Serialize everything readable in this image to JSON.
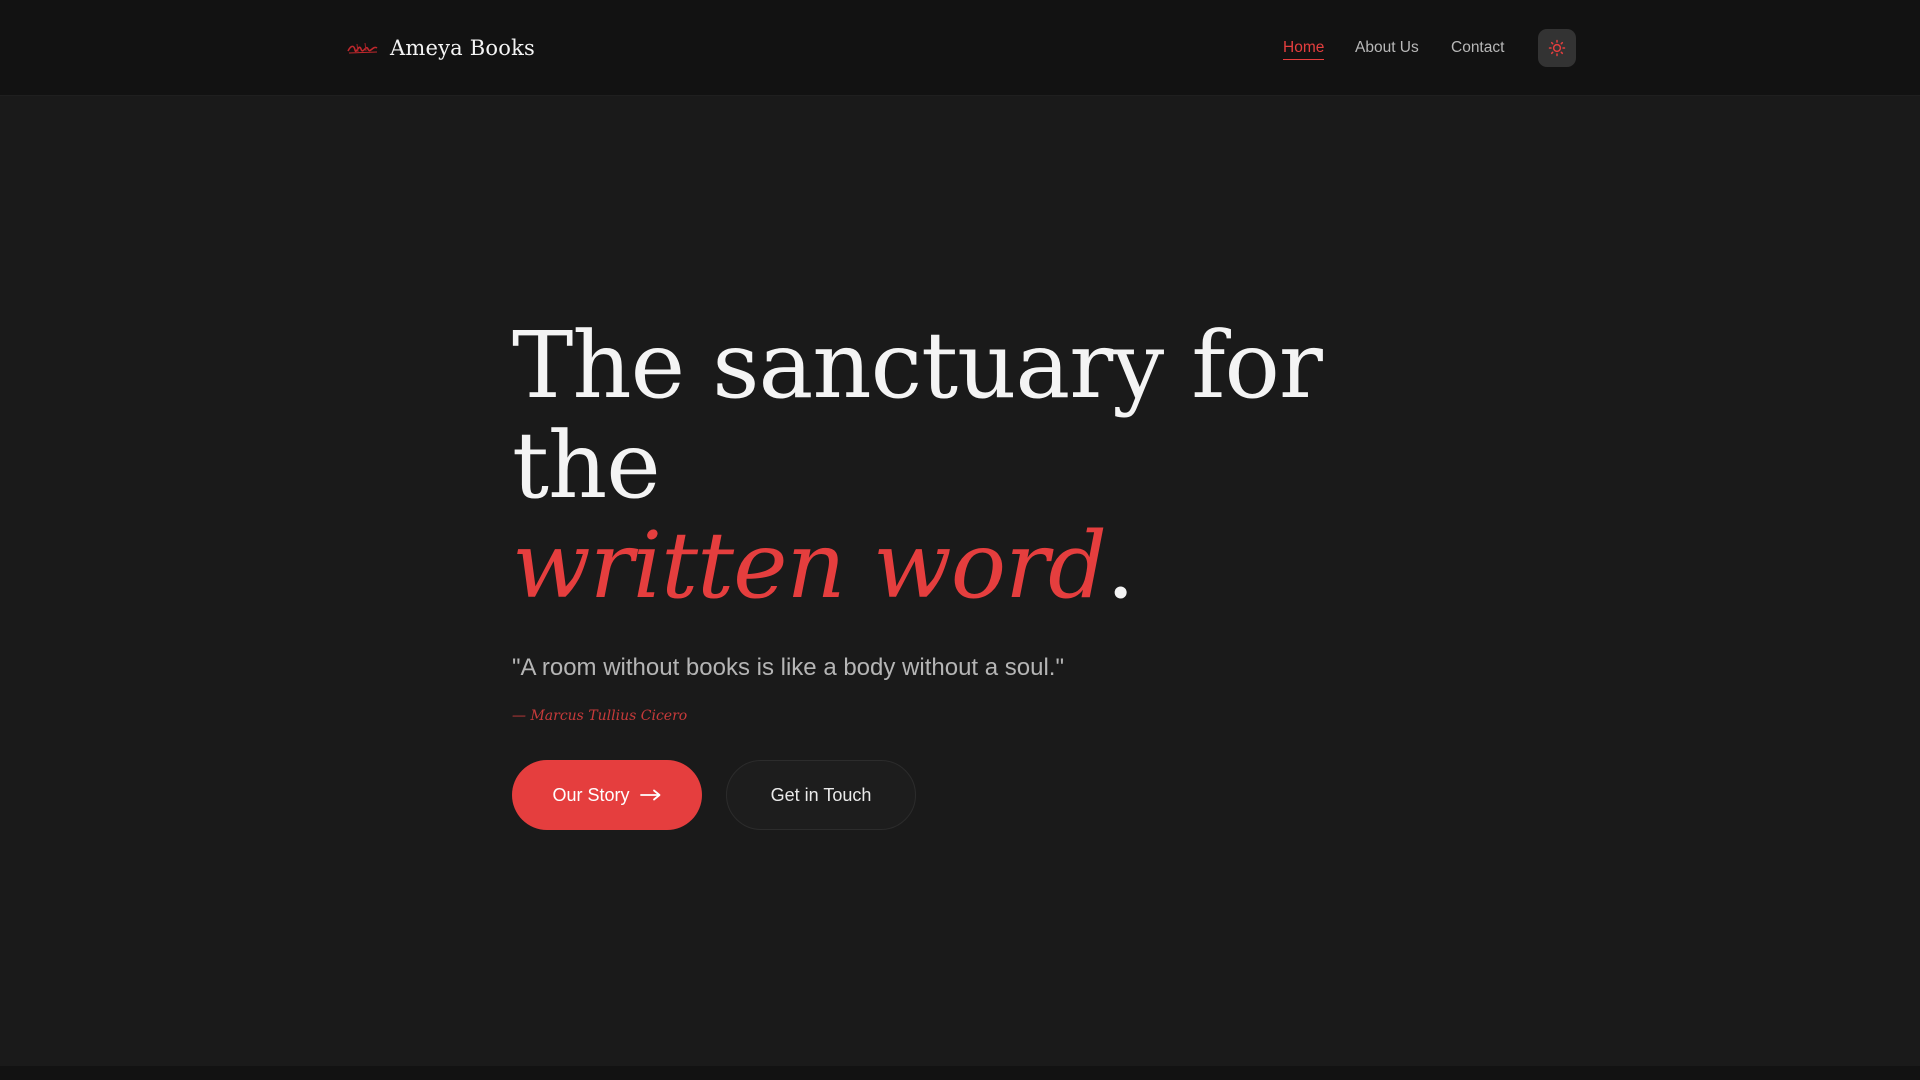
{
  "header": {
    "brand_name": "Ameya Books",
    "logo_icon": "book-script-logo-icon",
    "nav": {
      "home": "Home",
      "about": "About Us",
      "contact": "Contact",
      "active": "Home"
    },
    "theme_toggle_icon": "sun-icon"
  },
  "hero": {
    "headline_line1": "The sanctuary for",
    "headline_line2": "the",
    "headline_accent": "written word",
    "headline_dot": ".",
    "quote": "\"A room without books is like a body without a soul.\"",
    "attribution": "— Marcus Tullius Cicero",
    "primary_button": "Our Story",
    "primary_button_icon": "arrow-right-icon",
    "secondary_button": "Get in Touch"
  },
  "colors": {
    "accent": "#e53e3e",
    "background": "#1a1a1a",
    "header_background": "#121212"
  }
}
